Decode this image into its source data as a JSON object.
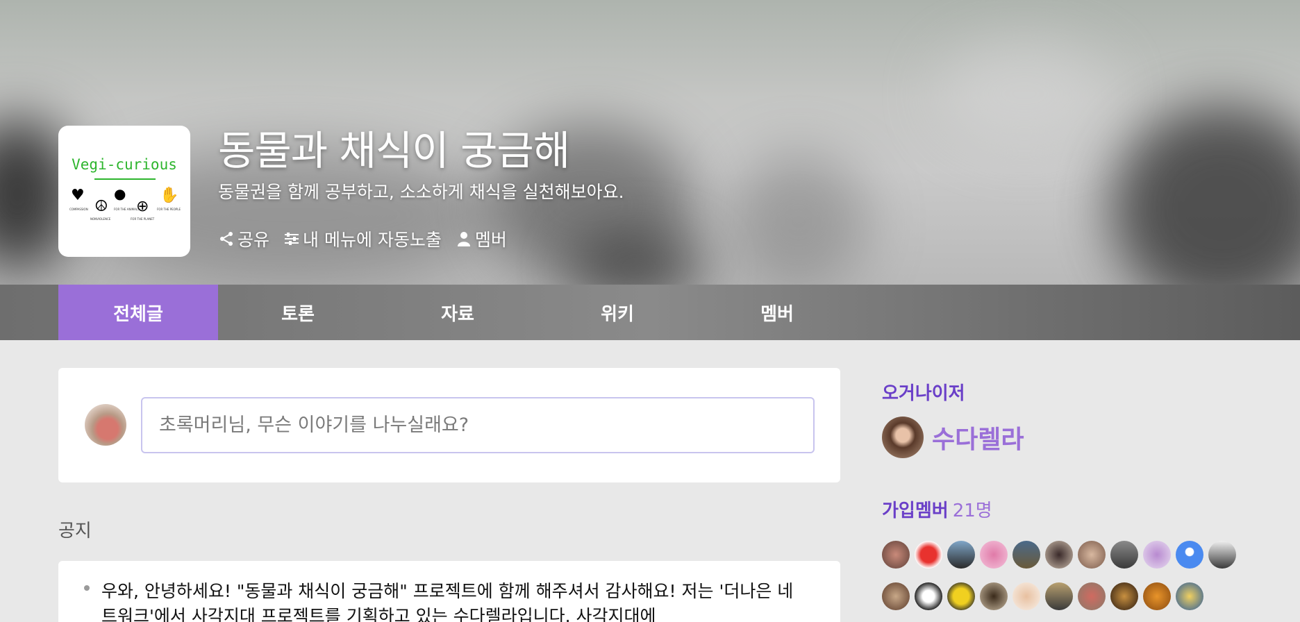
{
  "header": {
    "logo_text": "Vegi-curious",
    "logo_captions": [
      "COMPASSION",
      "NONVIOLENCE",
      "FOR THE ANIMALS",
      "FOR THE PLANET",
      "FOR THE PEOPLE"
    ],
    "title": "동물과 채식이 궁금해",
    "subtitle": "동물권을 함께 공부하고, 소소하게 채식을 실천해보아요.",
    "actions": [
      {
        "label": "공유",
        "icon": "share-icon"
      },
      {
        "label": "내 메뉴에 자동노출",
        "icon": "sliders-icon"
      },
      {
        "label": "멤버",
        "icon": "person-icon"
      }
    ]
  },
  "tabs": [
    {
      "label": "전체글",
      "active": true
    },
    {
      "label": "토론",
      "active": false
    },
    {
      "label": "자료",
      "active": false
    },
    {
      "label": "위키",
      "active": false
    },
    {
      "label": "멤버",
      "active": false
    }
  ],
  "compose": {
    "placeholder": "초록머리님, 무슨 이야기를 나누실래요?"
  },
  "notice": {
    "label": "공지",
    "text": "우와, 안녕하세요!  \"동물과 채식이 궁금해\" 프로젝트에 함께 해주셔서 감사해요!  저는 '더나은 네트워크'에서 사각지대 프로젝트를 기획하고 있는 수다렐라입니다.  사각지대에"
  },
  "sidebar": {
    "organizer_heading": "오거나이저",
    "organizer_name": "수다렐라",
    "members_heading": "가입멤버",
    "members_count": "21명"
  },
  "colors": {
    "accent": "#9a6fd8",
    "heading": "#6a3fc8",
    "logo_green": "#2db52d"
  }
}
